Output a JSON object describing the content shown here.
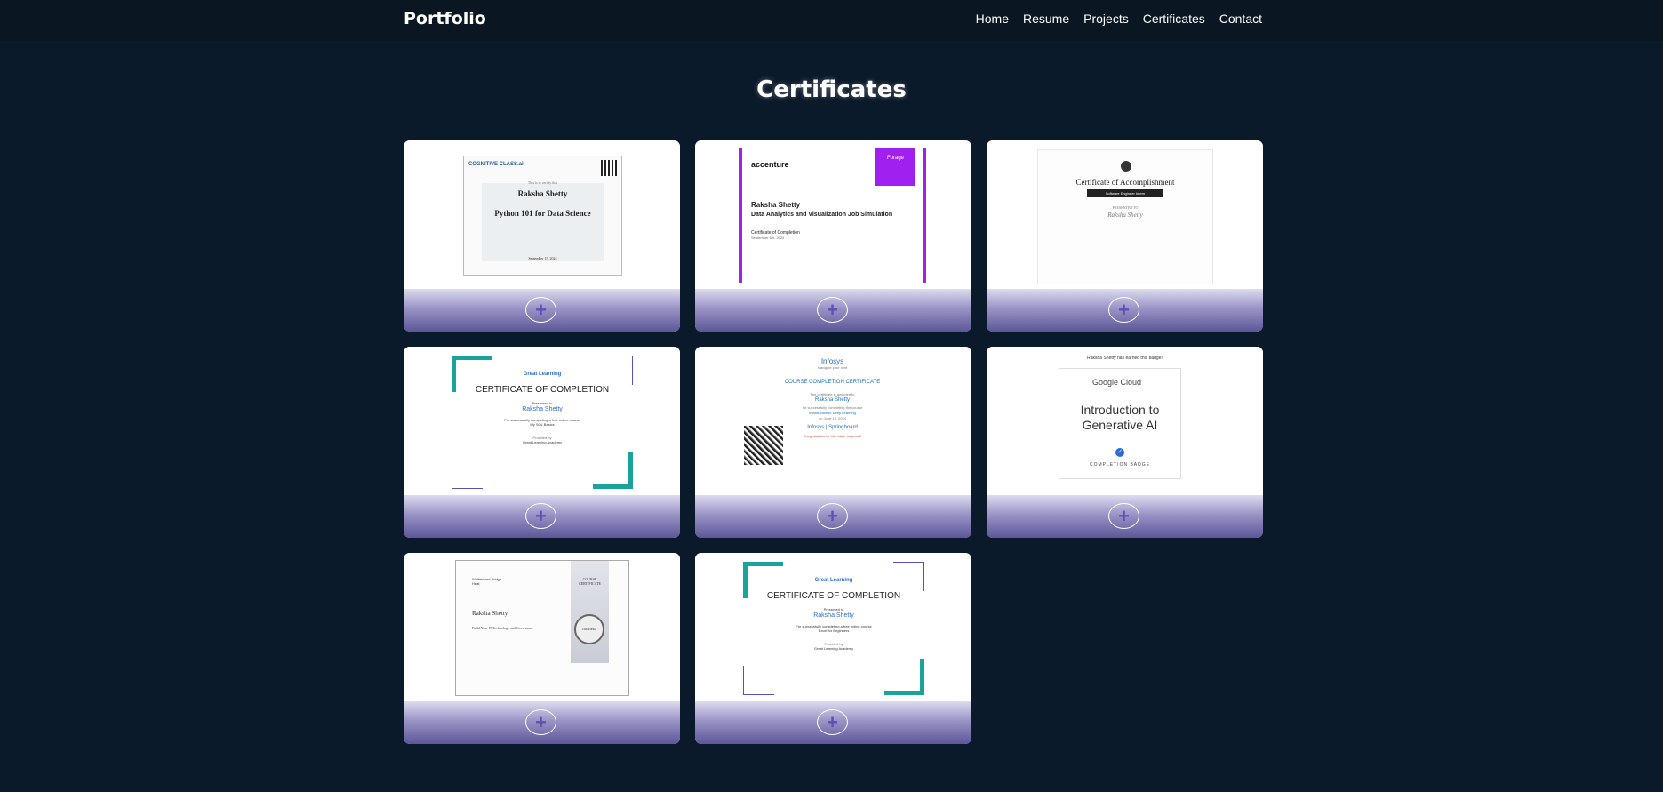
{
  "nav": {
    "brand": "Portfolio",
    "items": [
      "Home",
      "Resume",
      "Projects",
      "Certificates",
      "Contact"
    ]
  },
  "page": {
    "title": "Certificates"
  },
  "button_symbol": "+",
  "certificates": [
    {
      "issuer_logo": "COGNITIVE CLASS.ai",
      "line1": "This is to certify that",
      "name": "Raksha Shetty",
      "course": "Python 101 for Data Science",
      "date": "September 15, 2024"
    },
    {
      "issuer_logo": "accenture",
      "badge": "Forage",
      "name": "Raksha Shetty",
      "course": "Data Analytics and Visualization Job Simulation",
      "type": "Certificate of Completion",
      "date": "September 6th, 2024"
    },
    {
      "title": "Certificate of Accomplishment",
      "ribbon": "Software Engineer Intern",
      "presented": "PRESENTED TO",
      "name": "Raksha Shetty"
    },
    {
      "issuer_logo": "Great Learning",
      "title": "CERTIFICATE OF COMPLETION",
      "presented": "Presented to",
      "name": "Raksha Shetty",
      "line": "For successfully completing a free online course",
      "course": "My SQL Basics",
      "provider_label": "Provided by",
      "provider": "Great Learning Academy"
    },
    {
      "issuer_logo": "Infosys",
      "tagline": "Navigate your next",
      "title": "COURSE COMPLETION CERTIFICATE",
      "line1": "The certificate is awarded to",
      "name": "Raksha Shetty",
      "line2": "for successfully completing the course",
      "course": "Introduction to Deep Learning",
      "date": "on June 13, 2024",
      "brand2": "Infosys | Springboard",
      "congrats": "Congratulations! You make us proud!"
    },
    {
      "top_text": "Raksha Shetty has earned this badge!",
      "logo": "Google Cloud",
      "title": "Introduction to Generative AI",
      "badge": "COMPLETION BADGE"
    },
    {
      "issuer_logo": "Whiteboard Bridge Heat",
      "side_label": "COURSE CERTIFICATE",
      "name": "Raksha Shetty",
      "course": "Build Your IT Technology and Governance",
      "seal": "COURSERA"
    },
    {
      "issuer_logo": "Great Learning",
      "title": "CERTIFICATE OF COMPLETION",
      "presented": "Presented to",
      "name": "Raksha Shetty",
      "line": "For successfully completing a free online course",
      "course": "Excel for Beginners",
      "provider_label": "Provided by",
      "provider": "Great Learning Academy"
    }
  ],
  "colors": {
    "background": "#0b1a2b",
    "navbar": "#0a1622",
    "card_footer_bottom": "#5c5798",
    "accent_purple": "#5d4fb8",
    "forage_purple": "#a020f0",
    "gl_teal": "#1aa39a",
    "gl_blue": "#2b6cd4"
  }
}
